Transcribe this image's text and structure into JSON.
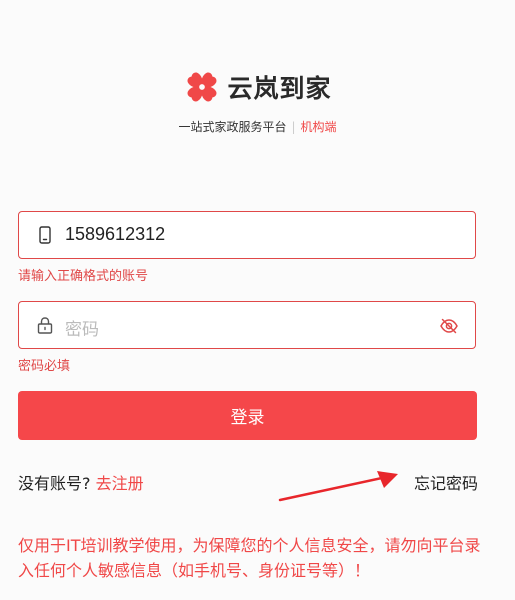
{
  "brand": {
    "name": "云岚到家",
    "tagline": "一站式家政服务平台",
    "role": "机构端",
    "color": "#f04848"
  },
  "phone_field": {
    "value": "1589612312",
    "icon": "phone-icon",
    "error": "请输入正确格式的账号"
  },
  "password_field": {
    "placeholder": "密码",
    "icon": "lock-icon",
    "toggle_icon": "eye-off-icon",
    "error": "密码必填"
  },
  "login_button": {
    "label": "登录",
    "color": "#f5474a"
  },
  "footer": {
    "no_account": "没有账号?",
    "register": "去注册",
    "forgot": "忘记密码"
  },
  "notice": "仅用于IT培训教学使用，为保障您的个人信息安全，请勿向平台录入任何个人敏感信息（如手机号、身份证号等）！"
}
